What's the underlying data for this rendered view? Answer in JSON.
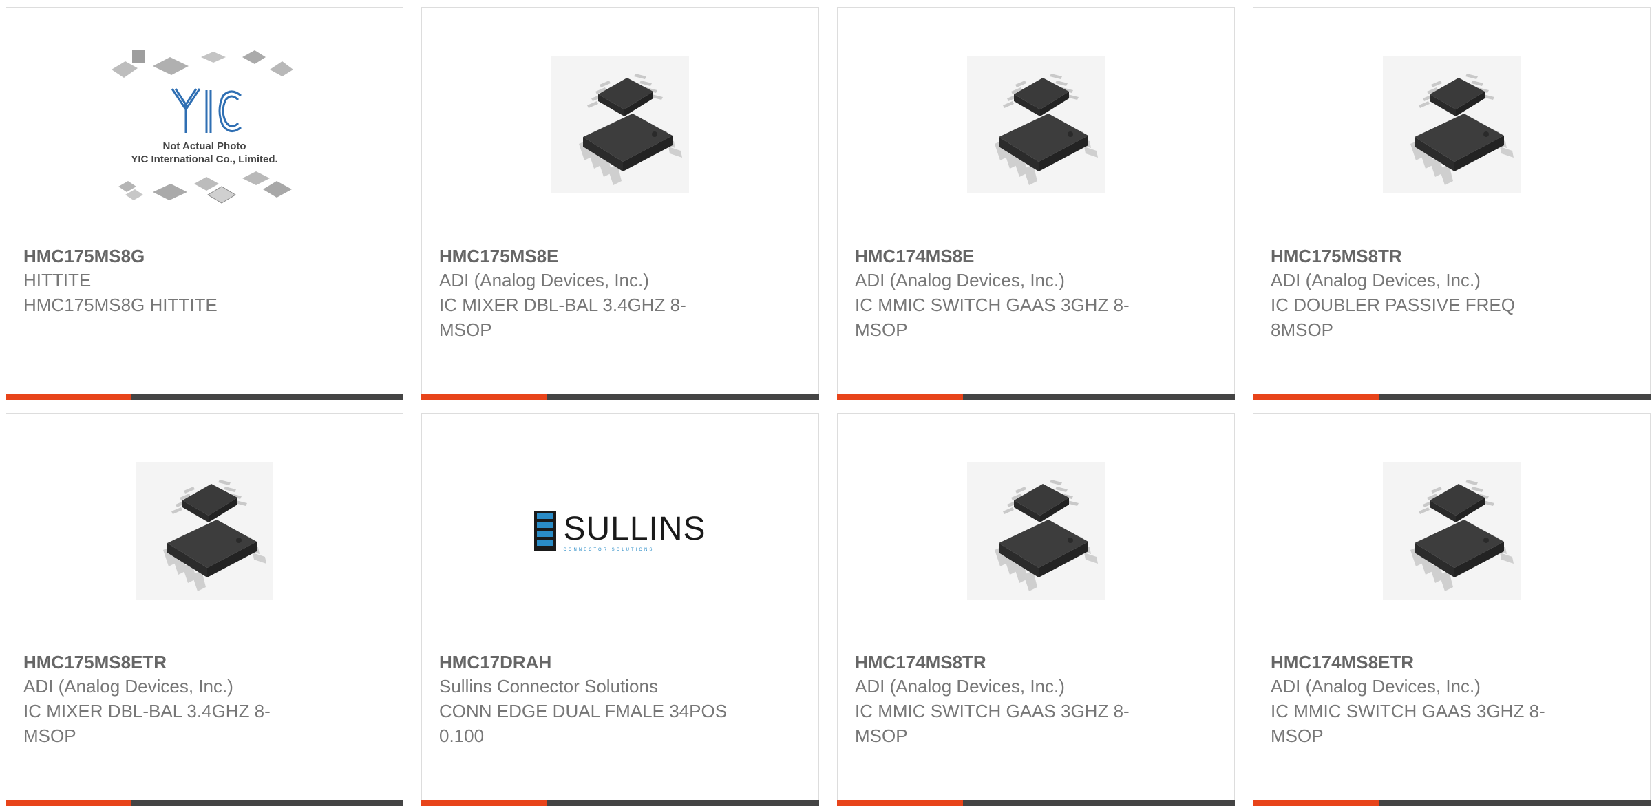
{
  "colors": {
    "accent": "#e8441a",
    "bar": "#444444",
    "text_bold": "#666666",
    "text": "#777777",
    "border": "#dddddd"
  },
  "products": [
    {
      "part_number": "HMC175MS8G",
      "manufacturer": "HITTITE",
      "description": "HMC175MS8G HITTITE",
      "image": "placeholder",
      "placeholder_title": "Not Actual Photo",
      "placeholder_company": "YIC International Co., Limited.",
      "placeholder_logo": "YIC"
    },
    {
      "part_number": "HMC175MS8E",
      "manufacturer": "ADI (Analog Devices, Inc.)",
      "description": "IC MIXER DBL-BAL 3.4GHZ 8-MSOP",
      "image": "msop-chip"
    },
    {
      "part_number": "HMC174MS8E",
      "manufacturer": "ADI (Analog Devices, Inc.)",
      "description": "IC MMIC SWITCH GAAS 3GHZ 8-MSOP",
      "image": "msop-chip"
    },
    {
      "part_number": "HMC175MS8TR",
      "manufacturer": "ADI (Analog Devices, Inc.)",
      "description": "IC DOUBLER PASSIVE FREQ 8MSOP",
      "image": "msop-chip"
    },
    {
      "part_number": "HMC175MS8ETR",
      "manufacturer": "ADI (Analog Devices, Inc.)",
      "description": "IC MIXER DBL-BAL 3.4GHZ 8-MSOP",
      "image": "msop-chip"
    },
    {
      "part_number": "HMC17DRAH",
      "manufacturer": "Sullins Connector Solutions",
      "description": "CONN EDGE DUAL FMALE 34POS 0.100",
      "image": "sullins-logo",
      "logo_word": "SULLINS",
      "logo_sub": "CONNECTOR SOLUTIONS"
    },
    {
      "part_number": "HMC174MS8TR",
      "manufacturer": "ADI (Analog Devices, Inc.)",
      "description": "IC MMIC SWITCH GAAS 3GHZ 8-MSOP",
      "image": "msop-chip"
    },
    {
      "part_number": "HMC174MS8ETR",
      "manufacturer": "ADI (Analog Devices, Inc.)",
      "description": "IC MMIC SWITCH GAAS 3GHZ 8-MSOP",
      "image": "msop-chip"
    }
  ]
}
